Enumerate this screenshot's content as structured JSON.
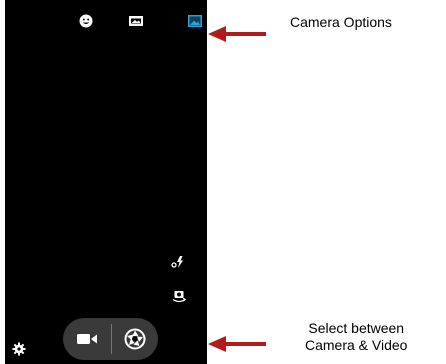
{
  "callouts": {
    "camera_options": "Camera Options",
    "select_mode_line1": "Select between",
    "select_mode_line2": "Camera & Video"
  },
  "icons": {
    "top_left": "face-detection-icon",
    "top_middle": "panorama-icon",
    "top_right": "gallery-icon",
    "flash": "flash-auto-icon",
    "switch_camera": "switch-camera-icon",
    "settings": "gear-icon",
    "video": "video-camera-icon",
    "shutter": "shutter-icon"
  },
  "colors": {
    "viewfinder": "#000000",
    "arrow": "#b11b1b",
    "highlight_icon": "#29a3d8",
    "control_pill": "#3a3a3a"
  }
}
